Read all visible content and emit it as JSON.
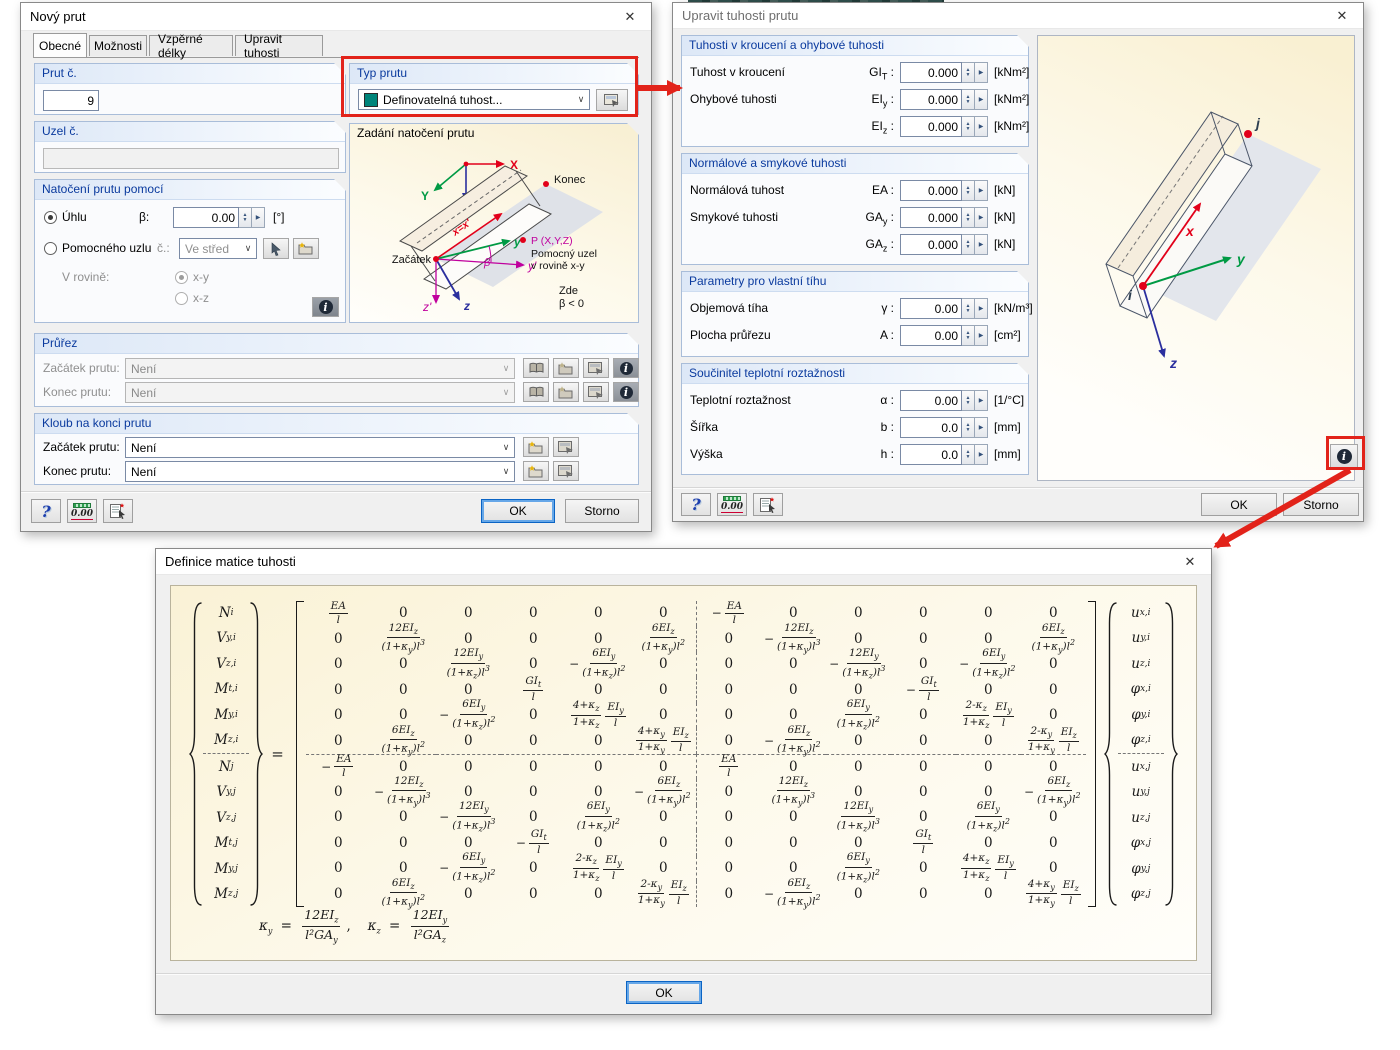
{
  "icons": {
    "close": "✕",
    "chevron": "∨",
    "spin_up": "▲",
    "spin_down": "▼",
    "spin_right": "▶",
    "help": "?",
    "info": "i",
    "units": "0.00"
  },
  "colors": {
    "accent_red": "#e2231a",
    "member_type_swatch": "#00857a",
    "group_caption": "#0a3a9e"
  },
  "dialog_new_member": {
    "title": "Nový prut",
    "tabs": [
      {
        "label": "Obecné"
      },
      {
        "label": "Možnosti"
      },
      {
        "label": "Vzpěrné délky"
      },
      {
        "label": "Upravit tuhosti"
      }
    ],
    "member_no": {
      "label": "Prut č.",
      "value": "9"
    },
    "node_no": {
      "label": "Uzel č.",
      "value": ""
    },
    "member_type": {
      "label": "Typ prutu",
      "value": "Definovatelná tuhost..."
    },
    "rotation": {
      "label": "Natočení prutu pomocí",
      "angle_option": "Úhlu",
      "beta_label": "β:",
      "beta_value": "0.00",
      "beta_unit": "[°]",
      "aux_option": "Pomocného uzlu",
      "aux_no_label": "č.:",
      "aux_no_value": "Ve střed",
      "plane_label": "V rovině:",
      "plane_xy": "x-y",
      "plane_xz": "x-z"
    },
    "diagram": {
      "label": "Zadání natočení prutu",
      "labels": {
        "x_global": "X",
        "y_global": "Y",
        "z_global": "Z",
        "konec": "Konec",
        "zacatek": "Začátek",
        "x_local": "x=x'",
        "y_local": "y",
        "y_rot": "y'",
        "beta": "β",
        "z_rot": "z'",
        "z_local": "z",
        "p": "P (X,Y,Z)",
        "aux_line1": "Pomocný uzel",
        "aux_line2": "v rovině x-y",
        "zde": "Zde",
        "beta_note": "β < 0"
      }
    },
    "cross_section": {
      "label": "Průřez",
      "rows": [
        {
          "label": "Začátek prutu:",
          "value": "Není"
        },
        {
          "label": "Konec prutu:",
          "value": "Není"
        }
      ]
    },
    "hinge": {
      "label": "Kloub na konci prutu",
      "rows": [
        {
          "label": "Začátek prutu:",
          "value": "Není"
        },
        {
          "label": "Konec prutu:",
          "value": "Není"
        }
      ]
    },
    "ok": "OK",
    "cancel": "Storno"
  },
  "dialog_stiffness": {
    "title": "Upravit tuhosti prutu",
    "sections": [
      {
        "label": "Tuhosti v kroucení a ohybové tuhosti",
        "rows": [
          {
            "label": "Tuhost v kroucení",
            "sym": "GI_T :",
            "value": "0.000",
            "unit": "[kNm²]"
          },
          {
            "label": "Ohybové tuhosti",
            "sym": "EI_y :",
            "value": "0.000",
            "unit": "[kNm²]"
          },
          {
            "label": "",
            "sym": "EI_z :",
            "value": "0.000",
            "unit": "[kNm²]"
          }
        ]
      },
      {
        "label": "Normálové a smykové tuhosti",
        "rows": [
          {
            "label": "Normálová tuhost",
            "sym": "EA :",
            "value": "0.000",
            "unit": "[kN]"
          },
          {
            "label": "Smykové tuhosti",
            "sym": "GA_y :",
            "value": "0.000",
            "unit": "[kN]"
          },
          {
            "label": "",
            "sym": "GA_z :",
            "value": "0.000",
            "unit": "[kN]"
          }
        ]
      },
      {
        "label": "Parametry pro vlastní tíhu",
        "rows": [
          {
            "label": "Objemová tíha",
            "sym": "γ :",
            "value": "0.00",
            "unit": "[kN/m³]"
          },
          {
            "label": "Plocha průřezu",
            "sym": "A :",
            "value": "0.00",
            "unit": "[cm²]"
          }
        ]
      },
      {
        "label": "Součinitel teplotní roztažnosti",
        "rows": [
          {
            "label": "Teplotní roztažnost",
            "sym": "α :",
            "value": "0.00",
            "unit": "[1/°C]"
          },
          {
            "label": "Šířka",
            "sym": "b :",
            "value": "0.0",
            "unit": "[mm]"
          },
          {
            "label": "Výška",
            "sym": "h :",
            "value": "0.0",
            "unit": "[mm]"
          }
        ]
      }
    ],
    "diagram": {
      "labels": {
        "i": "i",
        "j": "j",
        "x": "x",
        "y": "y",
        "z": "z"
      }
    },
    "ok": "OK",
    "cancel": "Storno"
  },
  "dialog_matrix": {
    "title": "Definice matice tuhosti",
    "ok": "OK",
    "left_vector": [
      "N_i",
      "V_{y,i}",
      "V_{z,i}",
      "M_{t,i}",
      "M_{y,i}",
      "M_{z,i}",
      "N_j",
      "V_{y,j}",
      "V_{z,j}",
      "M_{t,j}",
      "M_{y,j}",
      "M_{z,j}"
    ],
    "right_vector": [
      "u_{x,i}",
      "u_{y,i}",
      "u_{z,i}",
      "φ_{x,i}",
      "φ_{y,i}",
      "φ_{z,i}",
      "u_{x,j}",
      "u_{y,j}",
      "u_{z,j}",
      "φ_{x,j}",
      "φ_{y,j}",
      "φ_{z,j}"
    ],
    "matrix_rows": [
      [
        "EA/l",
        "0",
        "0",
        "0",
        "0",
        "0",
        "-EA/l",
        "0",
        "0",
        "0",
        "0",
        "0"
      ],
      [
        "0",
        "12EI_z/(1+κ_y)l^3",
        "0",
        "0",
        "0",
        "6EI_z/(1+κ_y)l^2",
        "0",
        "-12EI_z/(1+κ_y)l^3",
        "0",
        "0",
        "0",
        "6EI_z/(1+κ_y)l^2"
      ],
      [
        "0",
        "0",
        "12EI_y/(1+κ_z)l^3",
        "0",
        "-6EI_y/(1+κ_z)l^2",
        "0",
        "0",
        "0",
        "-12EI_y/(1+κ_z)l^3",
        "0",
        "-6EI_y/(1+κ_z)l^2",
        "0"
      ],
      [
        "0",
        "0",
        "0",
        "GI_t/l",
        "0",
        "0",
        "0",
        "0",
        "0",
        "-GI_t/l",
        "0",
        "0"
      ],
      [
        "0",
        "0",
        "-6EI_y/(1+κ_z)l^2",
        "0",
        "4+κ_z/1+κ_z*EI_y/l",
        "0",
        "0",
        "0",
        "6EI_y/(1+κ_z)l^2",
        "0",
        "2-κ_z/1+κ_z*EI_y/l",
        "0"
      ],
      [
        "0",
        "6EI_z/(1+κ_y)l^2",
        "0",
        "0",
        "0",
        "4+κ_y/1+κ_y*EI_z/l",
        "0",
        "-6EI_z/(1+κ_y)l^2",
        "0",
        "0",
        "0",
        "2-κ_y/1+κ_y*EI_z/l"
      ],
      [
        "-EA/l",
        "0",
        "0",
        "0",
        "0",
        "0",
        "EA/l",
        "0",
        "0",
        "0",
        "0",
        "0"
      ],
      [
        "0",
        "-12EI_z/(1+κ_y)l^3",
        "0",
        "0",
        "0",
        "-6EI_z/(1+κ_y)l^2",
        "0",
        "12EI_z/(1+κ_y)l^3",
        "0",
        "0",
        "0",
        "-6EI_z/(1+κ_y)l^2"
      ],
      [
        "0",
        "0",
        "-12EI_y/(1+κ_z)l^3",
        "0",
        "6EI_y/(1+κ_z)l^2",
        "0",
        "0",
        "0",
        "12EI_y/(1+κ_z)l^3",
        "0",
        "6EI_y/(1+κ_z)l^2",
        "0"
      ],
      [
        "0",
        "0",
        "0",
        "-GI_t/l",
        "0",
        "0",
        "0",
        "0",
        "0",
        "GI_t/l",
        "0",
        "0"
      ],
      [
        "0",
        "0",
        "-6EI_y/(1+κ_z)l^2",
        "0",
        "2-κ_z/1+κ_z*EI_y/l",
        "0",
        "0",
        "0",
        "6EI_y/(1+κ_z)l^2",
        "0",
        "4+κ_z/1+κ_z*EI_y/l",
        "0"
      ],
      [
        "0",
        "6EI_z/(1+κ_y)l^2",
        "0",
        "0",
        "0",
        "2-κ_y/1+κ_y*EI_z/l",
        "0",
        "-6EI_z/(1+κ_y)l^2",
        "0",
        "0",
        "0",
        "4+κ_y/1+κ_y*EI_z/l"
      ]
    ],
    "kappa_formulas": [
      "κ_y = 12EI_z/l²GA_y",
      "κ_z = 12EI_y/l²GA_z"
    ]
  }
}
